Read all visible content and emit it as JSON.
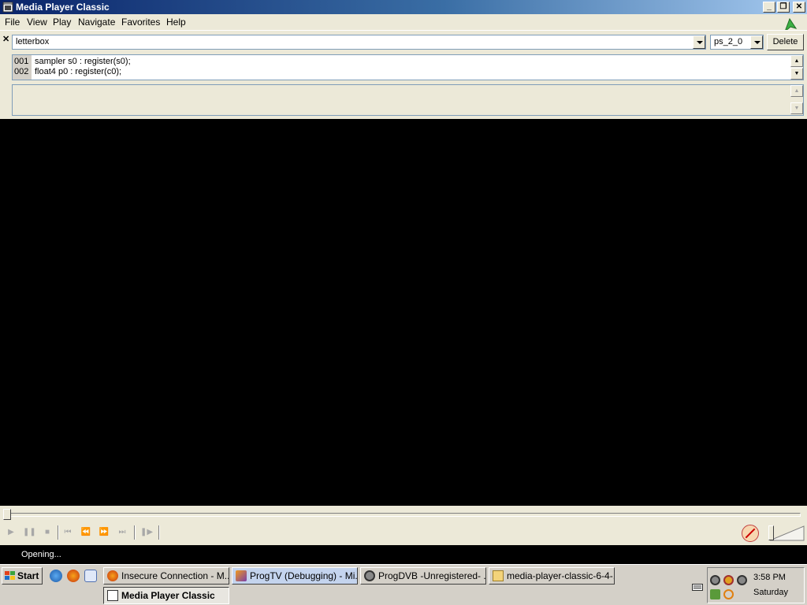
{
  "window": {
    "title": "Media Player Classic"
  },
  "menu": [
    "File",
    "View",
    "Play",
    "Navigate",
    "Favorites",
    "Help"
  ],
  "shader_editor": {
    "shader_name": "letterbox",
    "profile": "ps_2_0",
    "delete_label": "Delete",
    "code_lines": [
      {
        "num": "001",
        "text": "sampler s0 : register(s0);"
      },
      {
        "num": "002",
        "text": "float4 p0 : register(c0);"
      }
    ]
  },
  "status": {
    "text": "Opening..."
  },
  "taskbar": {
    "start_label": "Start",
    "tasks": [
      {
        "label": "Insecure Connection - M...",
        "icon": "firefox-icon"
      },
      {
        "label": "ProgTV (Debugging) - Mi...",
        "icon": "visual-studio-icon"
      },
      {
        "label": "ProgDVB -Unregistered-  ...",
        "icon": "progdvb-icon"
      },
      {
        "label": "media-player-classic-6-4-...",
        "icon": "folder-icon"
      },
      {
        "label": "Media Player Classic",
        "icon": "mpc-icon",
        "active": true
      }
    ],
    "clock": "3:58 PM",
    "day": "Saturday"
  },
  "colors": {
    "title_bar": "#0a246a",
    "chrome": "#ece9d8",
    "video": "#000000"
  }
}
